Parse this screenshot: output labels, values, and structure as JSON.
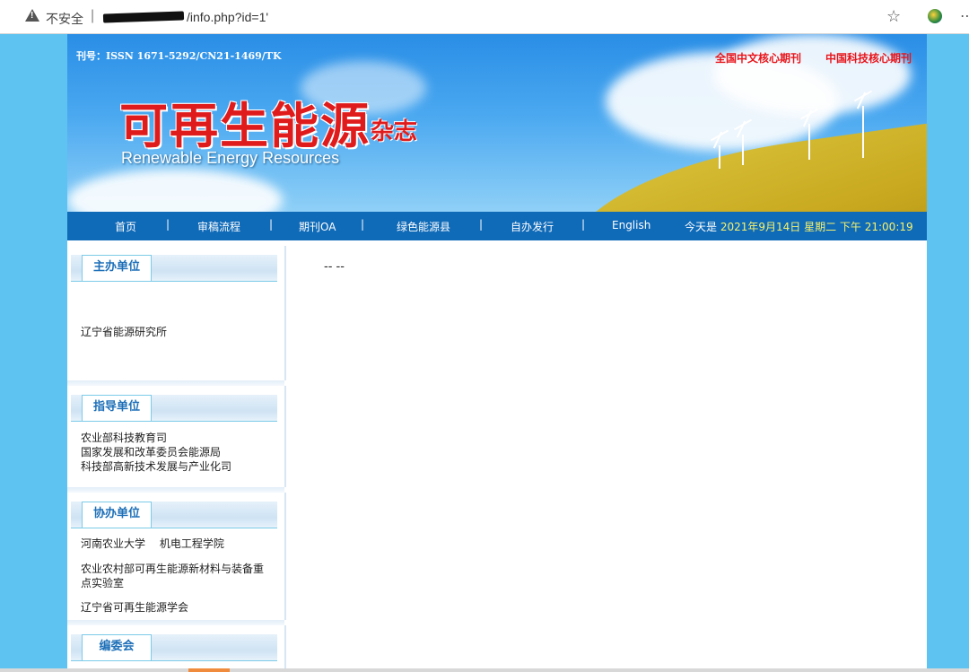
{
  "browser": {
    "security_label": "不安全",
    "separator": "|",
    "url": "/info.php?id=1'",
    "icons": [
      "warning-icon",
      "star-add-icon",
      "extension-icon"
    ]
  },
  "header": {
    "issn": "刊号：ISSN 1671-5292/CN21-1469/TK",
    "badge1": "全国中文核心期刊",
    "badge2": "中国科技核心期刊",
    "logo_cn": "可再生能源",
    "logo_magazine": "杂志",
    "logo_en": "Renewable Energy Resources"
  },
  "nav": {
    "items": [
      "首页",
      "审稿流程",
      "期刊OA",
      "绿色能源县",
      "自办发行",
      "English"
    ],
    "separator": "|",
    "today_label": "今天是",
    "today_value": "2021年9月14日 星期二 下午 21:00:19"
  },
  "sidebar": {
    "sponsor": {
      "title": "主办单位",
      "lines": [
        "辽宁省能源研究所"
      ]
    },
    "guide": {
      "title": "指导单位",
      "lines": [
        "农业部科技教育司",
        "国家发展和改革委员会能源局",
        "科技部高新技术发展与产业化司"
      ]
    },
    "co_org": {
      "title": "协办单位",
      "lines": [
        "河南农业大学　  机电工程学院",
        "农业农村部可再生能源新材料与装备重",
        "点实验室",
        "辽宁省可再生能源学会"
      ]
    },
    "editorial": {
      "title": "编委会"
    }
  },
  "main": {
    "content": "-- --"
  },
  "colors": {
    "outer_bg": "#5ec3f1",
    "nav_bg": "#0f6ab8",
    "badge_red": "#e8141a",
    "date_yellow": "#f7f26b",
    "sidebar_title": "#1d6fb8"
  }
}
